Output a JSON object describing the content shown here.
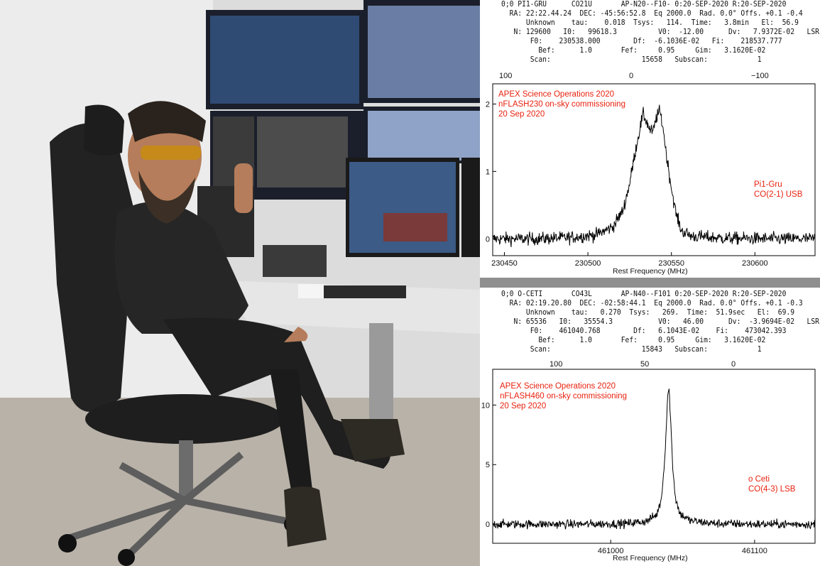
{
  "photo": {
    "description_icon": "person-in-control-room-photo"
  },
  "panels": [
    {
      "header_lines": [
        "0;0 PI1-GRU      CO21U       AP-N20--F10- 0:20-SEP-2020 R:20-SEP-2020",
        "  RA: 22:22.44.24  DEC: -45:56:52.8  Eq 2000.0  Rad. 0.0° Offs. +0.1 -0.4",
        "      Unknown    tau:    0.018  Tsys:   114.  Time:   3.8min   El:  56.9",
        "   N: 129600   I0:   99618.3          V0:  -12.00      Dv:   7.9372E-02   LSR",
        "       F0:    230538.000        Df:  -6.1036E-02   Fi:    218537.777",
        "         Bef:      1.0       Fef:     0.95     Gim:   3.1620E-02",
        "       Scan:                      15658   Subscan:            1"
      ],
      "top_axis_ticks": [
        "100",
        "0",
        "−100"
      ],
      "annotation_left": [
        "APEX Science Operations 2020",
        "nFLASH230 on-sky commissioning",
        "20 Sep 2020"
      ],
      "annotation_right": [
        "Pi1-Gru",
        "CO(2-1) USB"
      ],
      "xlabel": "Rest Frequency (MHz)"
    },
    {
      "header_lines": [
        "0;0 O-CETI       CO43L       AP-N40--F101 0:20-SEP-2020 R:20-SEP-2020",
        "  RA: 02:19.20.80  DEC: -02:58:44.1  Eq 2000.0  Rad. 0.0° Offs. +0.1 -0.3",
        "      Unknown    tau:   0.270  Tsys:   269.  Time:  51.9sec   El:  69.9",
        "   N: 65536   I0:   35554.3           V0:   46.00      Dv:  -3.9694E-02   LSR",
        "       F0:    461040.768        Df:   6.1043E-02    Fi:    473042.393",
        "         Bef:      1.0       Fef:     0.95     Gim:   3.1620E-02",
        "       Scan:                      15843   Subscan:            1"
      ],
      "top_axis_ticks": [
        "100",
        "50",
        "0"
      ],
      "annotation_left": [
        "APEX Science Operations 2020",
        "nFLASH460 on-sky commissioning",
        "20 Sep 2020"
      ],
      "annotation_right": [
        "o Ceti",
        "CO(4-3) LSB"
      ],
      "xlabel": "Rest Frequency (MHz)"
    }
  ],
  "chart_data": [
    {
      "type": "line",
      "title": "",
      "xlabel": "Rest Frequency (MHz)",
      "ylabel": "",
      "xlim": [
        230443,
        230636
      ],
      "ylim": [
        -0.25,
        2.3
      ],
      "xticks": [
        230450,
        230500,
        230550,
        230600
      ],
      "yticks": [
        0,
        1,
        2
      ],
      "top_axis_label_values": [
        "100",
        "0",
        "−100"
      ],
      "series": [
        {
          "name": "",
          "x": [
            230443,
            230470,
            230490,
            230505,
            230515,
            230521,
            230525,
            230528,
            230531,
            230533,
            230535,
            230537,
            230539,
            230541,
            230543,
            230545,
            230547,
            230550,
            230553,
            230556,
            230562,
            230580,
            230610,
            230636
          ],
          "y": [
            0.0,
            0.0,
            0.02,
            0.06,
            0.18,
            0.42,
            0.82,
            1.25,
            1.62,
            1.85,
            1.75,
            1.62,
            1.58,
            1.8,
            1.9,
            1.65,
            1.25,
            0.75,
            0.35,
            0.12,
            0.04,
            0.01,
            0.0,
            0.0
          ]
        }
      ],
      "noise_level": 0.09,
      "color": "#000000",
      "annotation_color": "#e8210e"
    },
    {
      "type": "line",
      "title": "",
      "xlabel": "Rest Frequency (MHz)",
      "ylabel": "",
      "xlim": [
        460918,
        461142
      ],
      "ylim": [
        -1.6,
        13.0
      ],
      "xticks": [
        461000,
        461100
      ],
      "yticks": [
        0,
        5,
        10
      ],
      "top_axis_label_values": [
        "100",
        "50",
        "0"
      ],
      "series": [
        {
          "name": "",
          "x": [
            460918,
            460980,
            461010,
            461025,
            461032,
            461035,
            461037,
            461038.5,
            461039.5,
            461040.5,
            461041.5,
            461043,
            461045,
            461048,
            461055,
            461070,
            461100,
            461142
          ],
          "y": [
            0.0,
            0.0,
            0.05,
            0.25,
            0.8,
            2.0,
            4.5,
            7.8,
            10.7,
            11.4,
            9.2,
            5.0,
            2.2,
            0.9,
            0.3,
            0.08,
            0.0,
            0.0
          ]
        }
      ],
      "noise_level": 0.35,
      "color": "#000000",
      "annotation_color": "#e8210e"
    }
  ]
}
